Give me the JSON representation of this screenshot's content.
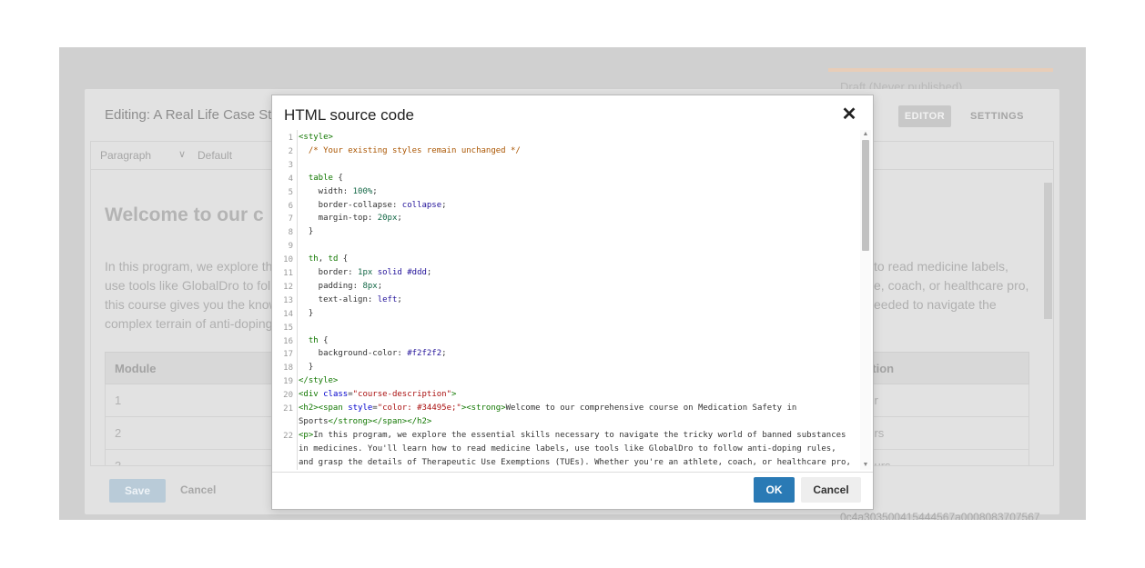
{
  "background": {
    "status": "Draft (Never published)",
    "hash": "0c4a303500415444567a0008083707567",
    "editor": {
      "title": "Editing: A Real Life Case Study",
      "tabs": {
        "editor": "EDITOR",
        "settings": "SETTINGS"
      },
      "toolbar": {
        "block_format": "Paragraph",
        "style": "Default"
      },
      "heading": "Welcome to our c",
      "paragraph_left": [
        "In this program, we explore th",
        "use tools like GlobalDro to foll",
        "this course gives you the know",
        "complex terrain of anti-doping"
      ],
      "paragraph_right": [
        "to read medicine labels,",
        "e, coach, or healthcare pro,",
        "eeded to navigate the"
      ],
      "table": {
        "headers": {
          "module": "Module",
          "duration": "ration"
        },
        "rows": [
          {
            "module": "1",
            "duration": "our"
          },
          {
            "module": "2",
            "duration": "ours"
          },
          {
            "module": "3",
            "duration": "hours"
          }
        ]
      },
      "save_label": "Save",
      "cancel_label": "Cancel"
    }
  },
  "modal": {
    "title": "HTML source code",
    "close_glyph": "✕",
    "ok_label": "OK",
    "cancel_label": "Cancel",
    "code_lines": [
      {
        "n": "1",
        "html": "<span class='t-tag'>&lt;style&gt;</span>"
      },
      {
        "n": "2",
        "html": "  <span class='t-cmt'>/* Your existing styles remain unchanged */</span>"
      },
      {
        "n": "3",
        "html": ""
      },
      {
        "n": "4",
        "html": "  <span class='t-tag'>table</span> {"
      },
      {
        "n": "5",
        "html": "    width: <span class='t-num'>100%</span>;"
      },
      {
        "n": "6",
        "html": "    border-collapse: <span class='t-kw'>collapse</span>;"
      },
      {
        "n": "7",
        "html": "    margin-top: <span class='t-num'>20px</span>;"
      },
      {
        "n": "8",
        "html": "  }"
      },
      {
        "n": "9",
        "html": ""
      },
      {
        "n": "10",
        "html": "  <span class='t-tag'>th</span>, <span class='t-tag'>td</span> {"
      },
      {
        "n": "11",
        "html": "    border: <span class='t-num'>1px</span> <span class='t-kw'>solid</span> <span class='t-kw'>#ddd</span>;"
      },
      {
        "n": "12",
        "html": "    padding: <span class='t-num'>8px</span>;"
      },
      {
        "n": "13",
        "html": "    text-align: <span class='t-kw'>left</span>;"
      },
      {
        "n": "14",
        "html": "  }"
      },
      {
        "n": "15",
        "html": ""
      },
      {
        "n": "16",
        "html": "  <span class='t-tag'>th</span> {"
      },
      {
        "n": "17",
        "html": "    background-color: <span class='t-kw'>#f2f2f2</span>;"
      },
      {
        "n": "18",
        "html": "  }"
      },
      {
        "n": "19",
        "html": "<span class='t-tag'>&lt;/style&gt;</span>"
      },
      {
        "n": "20",
        "html": "<span class='t-tag'>&lt;div</span> <span class='t-attr'>class</span>=<span class='t-str'>\"course-description\"</span><span class='t-tag'>&gt;</span>"
      },
      {
        "n": "21",
        "html": "<span class='t-tag'>&lt;h2&gt;&lt;span</span> <span class='t-attr'>style</span>=<span class='t-str'>\"color: #34495e;\"</span><span class='t-tag'>&gt;&lt;strong&gt;</span>Welcome to our comprehensive course on Medication Safety in"
      },
      {
        "n": "",
        "html": "Sports<span class='t-tag'>&lt;/strong&gt;&lt;/span&gt;&lt;/h2&gt;</span>"
      },
      {
        "n": "22",
        "html": "<span class='t-tag'>&lt;p&gt;</span>In this program, we explore the essential skills necessary to navigate the tricky world of banned substances"
      },
      {
        "n": "",
        "html": "in medicines. You'll learn how to read medicine labels, use tools like GlobalDro to follow anti-doping rules,"
      },
      {
        "n": "",
        "html": "and grasp the details of Therapeutic Use Exemptions (TUEs). Whether you're an athlete, coach, or healthcare pro,"
      }
    ]
  }
}
